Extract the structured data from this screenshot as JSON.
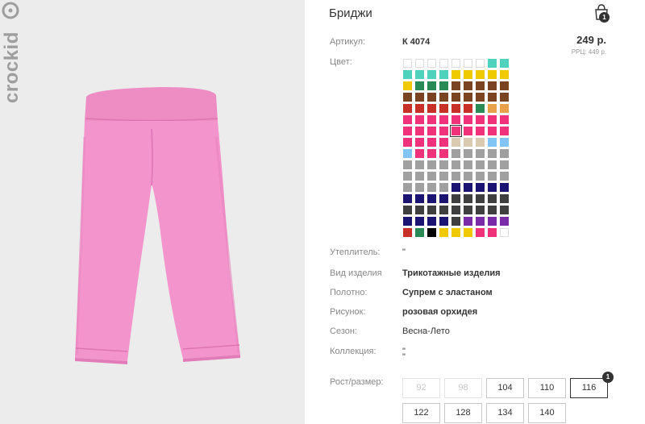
{
  "product": {
    "title": "Бриджи",
    "brand_logo_text": "crockid",
    "image_alt": "розовые бриджи"
  },
  "cart": {
    "icon": "shopping-bag-icon",
    "count": "1"
  },
  "article": {
    "label": "Артикул:",
    "value": "К 4074"
  },
  "price": {
    "value": "249 р.",
    "rrp": "РРЦ: 449 р."
  },
  "color": {
    "label": "Цвет:",
    "selected_index": 58,
    "swatches": [
      "empty",
      "empty",
      "empty",
      "empty",
      "empty",
      "empty",
      "empty",
      "#4ed2bd",
      "#4ed2bd",
      "#4ed2bd",
      "#4ed2bd",
      "#4ed2bd",
      "#4ed2bd",
      "#f0ca00",
      "#f0ca00",
      "#f0ca00",
      "#f0ca00",
      "#f0ca00",
      "#f0ca00",
      "#2a8a55",
      "#2a8a55",
      "#2a8a55",
      "#7a4423",
      "#7a4423",
      "#7a4423",
      "#7a4423",
      "#7a4423",
      "#7a4423",
      "#7a4423",
      "#7a4423",
      "#7a4423",
      "#7a4423",
      "#7a4423",
      "#7a4423",
      "#7a4423",
      "#7a4423",
      "#c63027",
      "#c63027",
      "#c63027",
      "#c63027",
      "#c63027",
      "#c63027",
      "#2a8a55",
      "#e9a04a",
      "#e9a04a",
      "#f0327a",
      "#f0327a",
      "#f0327a",
      "#f0327a",
      "#f0327a",
      "#f0327a",
      "#f0327a",
      "#f0327a",
      "#f0327a",
      "#f0327a",
      "#f0327a",
      "#f0327a",
      "#f0327a",
      "#f0327a",
      "#f0327a",
      "#f0327a",
      "#f0327a",
      "#f0327a",
      "#f0327a",
      "#f0327a",
      "#f0327a",
      "#f0327a",
      "#d8cbb0",
      "#d8cbb0",
      "#d8cbb0",
      "#82c4f3",
      "#82c4f3",
      "#82c4f3",
      "#f0327a",
      "#f0327a",
      "#f0327a",
      "#a0a0a0",
      "#a0a0a0",
      "#a0a0a0",
      "#a0a0a0",
      "#a0a0a0",
      "#a0a0a0",
      "#a0a0a0",
      "#a0a0a0",
      "#a0a0a0",
      "#a0a0a0",
      "#a0a0a0",
      "#a0a0a0",
      "#a0a0a0",
      "#a0a0a0",
      "#a0a0a0",
      "#a0a0a0",
      "#a0a0a0",
      "#a0a0a0",
      "#a0a0a0",
      "#a0a0a0",
      "#a0a0a0",
      "#a0a0a0",
      "#a0a0a0",
      "#a0a0a0",
      "#a0a0a0",
      "#a0a0a0",
      "#a0a0a0",
      "#1c1473",
      "#1c1473",
      "#1c1473",
      "#1c1473",
      "#1c1473",
      "#1c1473",
      "#1c1473",
      "#1c1473",
      "#1c1473",
      "#3f3f3f",
      "#3f3f3f",
      "#3f3f3f",
      "#3f3f3f",
      "#3f3f3f",
      "#3f3f3f",
      "#3f3f3f",
      "#3f3f3f",
      "#3f3f3f",
      "#3f3f3f",
      "#3f3f3f",
      "#3f3f3f",
      "#3f3f3f",
      "#3f3f3f",
      "#1c1473",
      "#1c1473",
      "#1c1473",
      "#1c1473",
      "#3f3f3f",
      "#7a2ca8",
      "#7a2ca8",
      "#7a2ca8",
      "#7a2ca8",
      "#c63027",
      "#2a8a55",
      "#000000",
      "#f0ca00",
      "#f0ca00",
      "#f0ca00",
      "#f0327a",
      "#f0327a",
      "empty"
    ]
  },
  "details": [
    {
      "label": "Утеплитель:",
      "value": "\"",
      "bold": false
    },
    {
      "label": "Вид изделия",
      "value": "Трикотажные изделия",
      "bold": true
    },
    {
      "label": "Полотно:",
      "value": "Супрем с эластаном",
      "bold": true
    },
    {
      "label": "Рисунок:",
      "value": "розовая орхидея",
      "bold": true
    },
    {
      "label": "Сезон:",
      "value": "Весна-Лето",
      "bold": false
    },
    {
      "label": "Коллекция:",
      "value": "\"",
      "bold": false
    }
  ],
  "collection_extra": "\"",
  "size": {
    "label": "Рост/размер:",
    "options": [
      {
        "label": "92",
        "state": "disabled"
      },
      {
        "label": "98",
        "state": "disabled"
      },
      {
        "label": "104",
        "state": "available"
      },
      {
        "label": "110",
        "state": "available"
      },
      {
        "label": "116",
        "state": "active",
        "badge": "1"
      },
      {
        "label": "122",
        "state": "available"
      },
      {
        "label": "128",
        "state": "available"
      },
      {
        "label": "134",
        "state": "available"
      },
      {
        "label": "140",
        "state": "available"
      }
    ]
  }
}
